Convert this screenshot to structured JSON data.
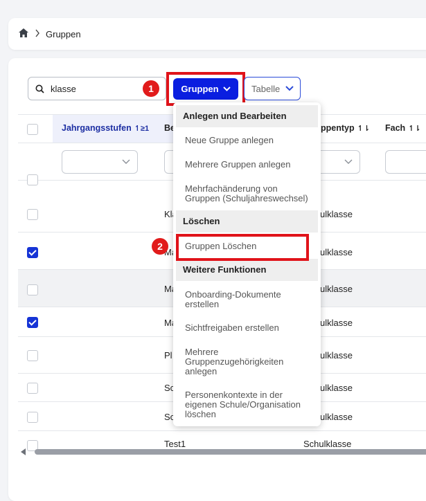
{
  "breadcrumb": {
    "current": "Gruppen"
  },
  "search": {
    "value": "klasse"
  },
  "toolbar": {
    "gruppen_label": "Gruppen",
    "tabelle_label": "Tabelle"
  },
  "markers": [
    "1",
    "2"
  ],
  "table": {
    "columns": [
      {
        "label": "Jahrgangsstufen",
        "sort_indicator": "↿≥1",
        "sorted": true
      },
      {
        "label": "Be",
        "sort_indicator": ""
      },
      {
        "label": "ppentyp",
        "sort_indicator": "↿⇂"
      },
      {
        "label": "Fach",
        "sort_indicator": "↿⇂"
      }
    ],
    "rows": [
      {
        "checked": false,
        "bez": "Kla",
        "typ": "ulklasse"
      },
      {
        "checked": true,
        "bez": "Ma",
        "typ": "ulklasse"
      },
      {
        "checked": false,
        "bez": "Ma",
        "typ": "ulklasse"
      },
      {
        "checked": true,
        "bez": "Ma",
        "typ": "ulklasse"
      },
      {
        "checked": false,
        "bez": "Pl",
        "typ": "ulklasse"
      },
      {
        "checked": false,
        "bez": "Sc",
        "typ": "ulklasse"
      },
      {
        "checked": false,
        "bez": "Sc",
        "typ": "ulklasse"
      },
      {
        "checked": false,
        "bez": "Test1",
        "typ": "Schulklasse"
      }
    ]
  },
  "menu": {
    "section_create": "Anlegen und Bearbeiten",
    "item_new_group": "Neue Gruppe anlegen",
    "item_multi_groups": "Mehrere Gruppen anlegen",
    "item_multi_change_1": "Mehrfachänderung von",
    "item_multi_change_2": "Gruppen (Schuljahreswechsel)",
    "section_delete": "Löschen",
    "item_delete_groups": "Gruppen Löschen",
    "section_more": "Weitere Funktionen",
    "item_onboarding_1": "Onboarding-Dokumente",
    "item_onboarding_2": "erstellen",
    "item_visibility": "Sichtfreigaben erstellen",
    "item_memberships_1": "Mehrere",
    "item_memberships_2": "Gruppenzugehörigkeiten",
    "item_memberships_3": "anlegen",
    "item_contexts_1": "Personenkontexte in der",
    "item_contexts_2": "eigenen Schule/Organisation",
    "item_contexts_3": "löschen"
  },
  "colors": {
    "primary": "#0a1ee0",
    "highlight": "#e0131a",
    "marker": "#e11b1b"
  }
}
